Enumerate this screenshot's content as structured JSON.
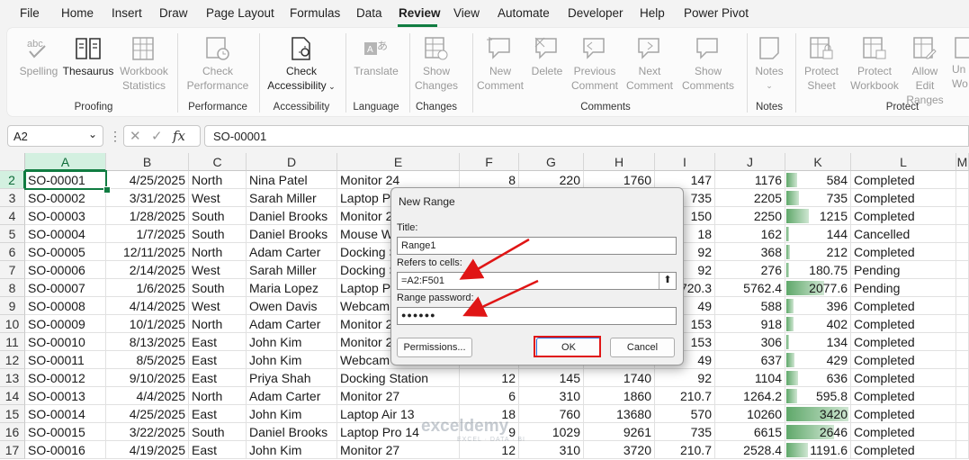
{
  "menu": [
    "File",
    "Home",
    "Insert",
    "Draw",
    "Page Layout",
    "Formulas",
    "Data",
    "Review",
    "View",
    "Automate",
    "Developer",
    "Help",
    "Power Pivot"
  ],
  "menu_active": "Review",
  "ribbon": {
    "spelling": "Spelling",
    "thesaurus": "Thesaurus",
    "workbook_stats": [
      "Workbook",
      "Statistics"
    ],
    "check_performance": [
      "Check",
      "Performance"
    ],
    "check_accessibility": [
      "Check",
      "Accessibility"
    ],
    "translate": "Translate",
    "show_changes": [
      "Show",
      "Changes"
    ],
    "new_comment": [
      "New",
      "Comment"
    ],
    "delete": "Delete",
    "previous_comment": [
      "Previous",
      "Comment"
    ],
    "next_comment": [
      "Next",
      "Comment"
    ],
    "show_comments": [
      "Show",
      "Comments"
    ],
    "notes": "Notes",
    "protect_sheet": [
      "Protect",
      "Sheet"
    ],
    "protect_workbook": [
      "Protect",
      "Workbook"
    ],
    "allow_edit_ranges": [
      "Allow Edit",
      "Ranges"
    ],
    "unprotect": [
      "Un",
      "Wo"
    ],
    "groups": [
      "Proofing",
      "Performance",
      "Accessibility",
      "Language",
      "Changes",
      "Comments",
      "Notes",
      "Protect"
    ]
  },
  "formula_bar": {
    "name_box": "A2",
    "formula": "SO-00001",
    "fx": "fx"
  },
  "columns": [
    "A",
    "B",
    "C",
    "D",
    "E",
    "F",
    "G",
    "H",
    "I",
    "J",
    "K",
    "L",
    "M"
  ],
  "rows": [
    [
      "2",
      "SO-00001",
      "4/25/2025",
      "North",
      "Nina Patel",
      "Monitor 24",
      "8",
      "220",
      "1760",
      "147",
      "1176",
      "584",
      "Completed"
    ],
    [
      "3",
      "SO-00002",
      "3/31/2025",
      "West",
      "Sarah Miller",
      "Laptop Pr",
      "",
      "",
      "",
      "735",
      "2205",
      "735",
      "Completed"
    ],
    [
      "4",
      "SO-00003",
      "1/28/2025",
      "South",
      "Daniel Brooks",
      "Monitor 2",
      "",
      "",
      "",
      "150",
      "2250",
      "1215",
      "Completed"
    ],
    [
      "5",
      "SO-00004",
      "1/7/2025",
      "South",
      "Daniel Brooks",
      "Mouse W",
      "",
      "",
      "",
      "18",
      "162",
      "144",
      "Cancelled"
    ],
    [
      "6",
      "SO-00005",
      "12/11/2025",
      "North",
      "Adam Carter",
      "Docking S",
      "",
      "",
      "",
      "92",
      "368",
      "212",
      "Completed"
    ],
    [
      "7",
      "SO-00006",
      "2/14/2025",
      "West",
      "Sarah Miller",
      "Docking S",
      "",
      "",
      "",
      "92",
      "276",
      "180.75",
      "Pending"
    ],
    [
      "8",
      "SO-00007",
      "1/6/2025",
      "South",
      "Maria Lopez",
      "Laptop Pr",
      "",
      "",
      "",
      "720.3",
      "5762.4",
      "2077.6",
      "Pending"
    ],
    [
      "9",
      "SO-00008",
      "4/14/2025",
      "West",
      "Owen Davis",
      "Webcam",
      "",
      "",
      "",
      "49",
      "588",
      "396",
      "Completed"
    ],
    [
      "10",
      "SO-00009",
      "10/1/2025",
      "North",
      "Adam Carter",
      "Monitor 2",
      "",
      "",
      "",
      "153",
      "918",
      "402",
      "Completed"
    ],
    [
      "11",
      "SO-00010",
      "8/13/2025",
      "East",
      "John Kim",
      "Monitor 2",
      "",
      "",
      "",
      "153",
      "306",
      "134",
      "Completed"
    ],
    [
      "12",
      "SO-00011",
      "8/5/2025",
      "East",
      "John Kim",
      "Webcam",
      "",
      "",
      "",
      "49",
      "637",
      "429",
      "Completed"
    ],
    [
      "13",
      "SO-00012",
      "9/10/2025",
      "East",
      "Priya Shah",
      "Docking Station",
      "12",
      "145",
      "1740",
      "92",
      "1104",
      "636",
      "Completed"
    ],
    [
      "14",
      "SO-00013",
      "4/4/2025",
      "North",
      "Adam Carter",
      "Monitor 27",
      "6",
      "310",
      "1860",
      "210.7",
      "1264.2",
      "595.8",
      "Completed"
    ],
    [
      "15",
      "SO-00014",
      "4/25/2025",
      "East",
      "John Kim",
      "Laptop Air 13",
      "18",
      "760",
      "13680",
      "570",
      "10260",
      "3420",
      "Completed"
    ],
    [
      "16",
      "SO-00015",
      "3/22/2025",
      "South",
      "Daniel Brooks",
      "Laptop Pro 14",
      "9",
      "1029",
      "9261",
      "735",
      "6615",
      "2646",
      "Completed"
    ],
    [
      "17",
      "SO-00016",
      "4/19/2025",
      "East",
      "John Kim",
      "Monitor 27",
      "12",
      "310",
      "3720",
      "210.7",
      "2528.4",
      "1191.6",
      "Completed"
    ]
  ],
  "databar_fractions": [
    0.17,
    0.21,
    0.36,
    0.04,
    0.06,
    0.05,
    0.61,
    0.12,
    0.12,
    0.04,
    0.13,
    0.19,
    0.17,
    1.0,
    0.77,
    0.35
  ],
  "dialog": {
    "title": "New Range",
    "title_label": "Title:",
    "title_value": "Range1",
    "refers_label": "Refers to cells:",
    "refers_value": "=A2:F501",
    "password_label": "Range password:",
    "password_value": "●●●●●●",
    "permissions": "Permissions...",
    "ok": "OK",
    "cancel": "Cancel"
  },
  "watermark": {
    "brand": "exceldemy",
    "tagline": "EXCEL · DATA · BI"
  },
  "colors": {
    "accent": "#107c41",
    "highlight": "#e01515",
    "databar": "#5fa86a"
  }
}
